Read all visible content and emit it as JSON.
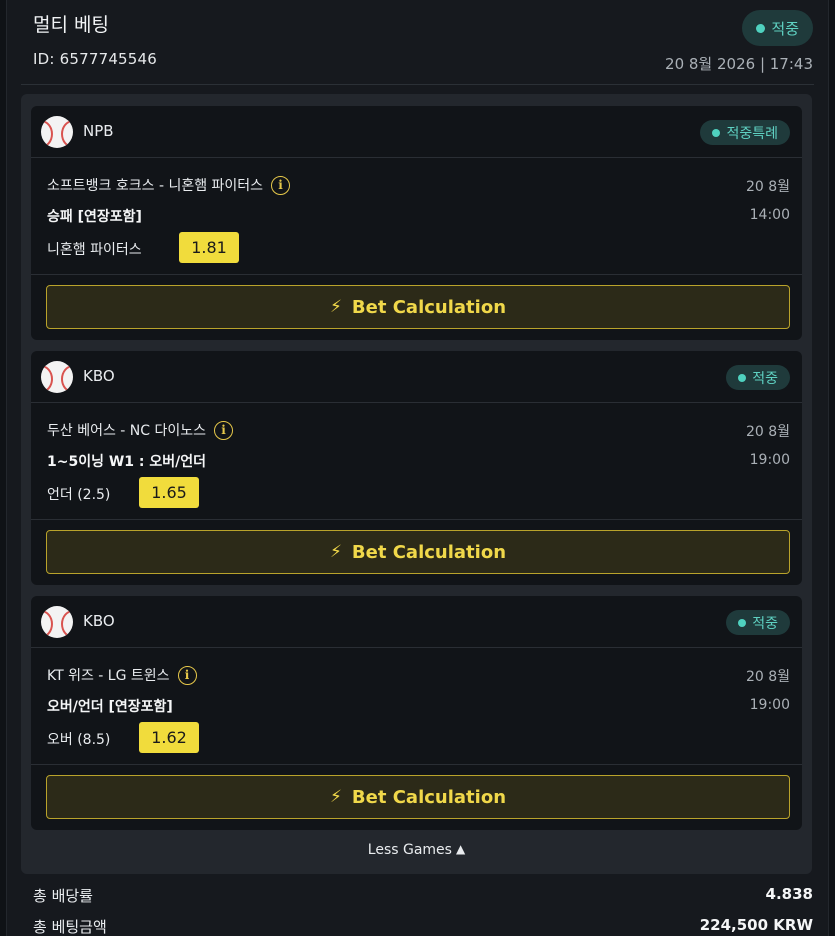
{
  "header": {
    "title": "멀티 베팅",
    "id_label": "ID: 6577745546",
    "status": "적중",
    "date": "20 8월 2026 | 17:43"
  },
  "bets": [
    {
      "league": "NPB",
      "status": "적중특례",
      "match": "소프트뱅크 호크스 - 니혼햄 파이터스",
      "date": "20 8월",
      "market": "승패 [연장포함]",
      "time": "14:00",
      "pick": "니혼햄 파이터스",
      "odds": "1.81",
      "button": "Bet Calculation"
    },
    {
      "league": "KBO",
      "status": "적중",
      "match": "두산 베어스 - NC 다이노스",
      "date": "20 8월",
      "market": "1~5이닝 W1 : 오버/언더",
      "time": "19:00",
      "pick": "언더 (2.5)",
      "odds": "1.65",
      "button": "Bet Calculation"
    },
    {
      "league": "KBO",
      "status": "적중",
      "match": "KT 위즈 - LG 트윈스",
      "date": "20 8월",
      "market": "오버/언더 [연장포함]",
      "time": "19:00",
      "pick": "오버 (8.5)",
      "odds": "1.62",
      "button": "Bet Calculation"
    }
  ],
  "less_games": "Less Games",
  "summary": {
    "total_odds_label": "총 배당률",
    "total_odds": "4.838",
    "total_stake_label": "총 베팅금액",
    "total_stake": "224,500 KRW"
  },
  "icons": {
    "info": "info-circle-icon",
    "sport": "baseball-icon",
    "calc": "lightning-bolt-icon",
    "less": "chevron-up-icon"
  },
  "colors": {
    "accent_yellow": "#f1dc3c",
    "status_teal": "#4fd1bf"
  }
}
